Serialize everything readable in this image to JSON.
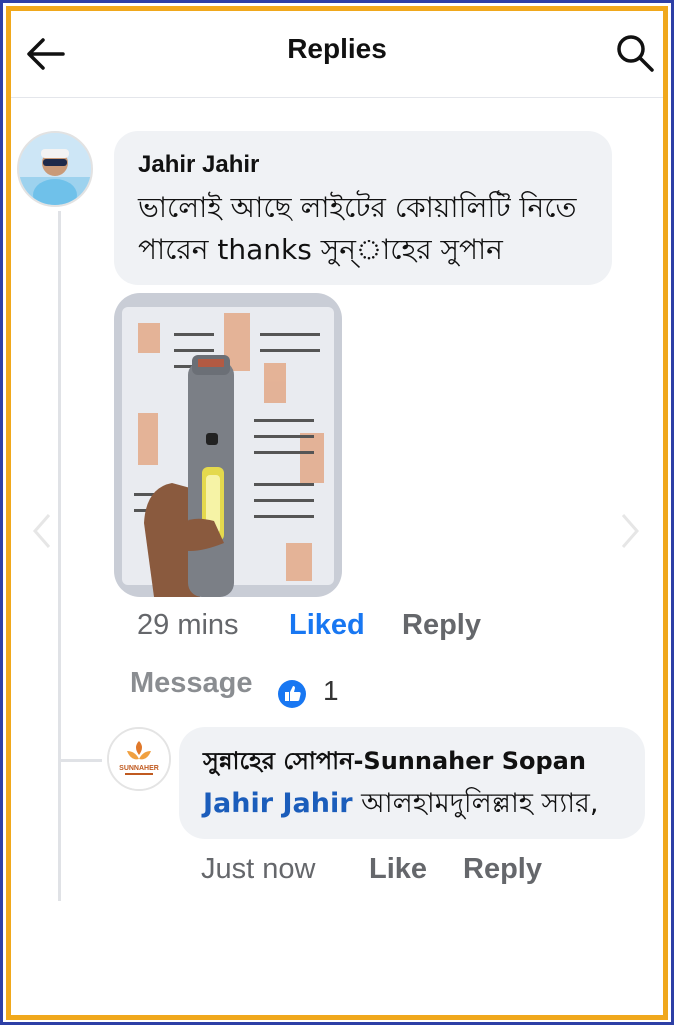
{
  "header": {
    "title": "Replies"
  },
  "comment": {
    "author": "Jahir Jahir",
    "text": "ভালোই আছে লাইটের কোয়ালিটি নিতে পারেন thanks সুন্াহের সুপান",
    "time": "29 mins",
    "liked_label": "Liked",
    "reply_label": "Reply",
    "message_label": "Message",
    "reaction_count": "1",
    "photo_description_icon": "flashlight-photo"
  },
  "reply": {
    "author": "সুন্নাহের সোপান-Sunnaher Sopan",
    "mention": "Jahir Jahir",
    "text": "আলহামদুলিল্লাহ স্যার,",
    "time": "Just now",
    "like_label": "Like",
    "reply_label": "Reply",
    "logo_text": "SUNNAHER"
  },
  "colors": {
    "accent_blue": "#1877f2",
    "frame_orange": "#f0a81c",
    "frame_blue": "#2d3fa6"
  }
}
